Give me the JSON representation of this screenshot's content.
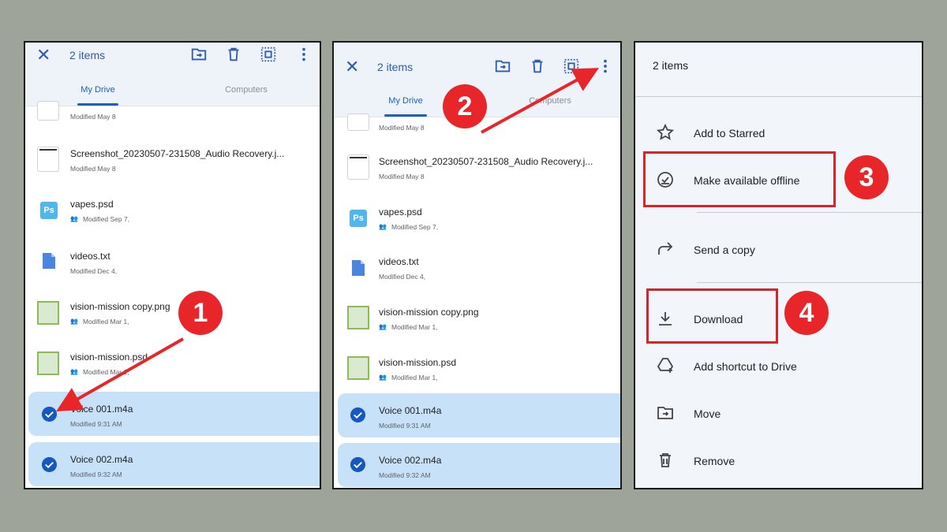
{
  "panel1": {
    "items_count": "2 items",
    "tabs": [
      "My Drive",
      "Computers"
    ],
    "files": [
      {
        "name": "",
        "meta": "Modified May 8",
        "icon": "document-thumbnail",
        "shared": false,
        "selected": false
      },
      {
        "name": "Screenshot_20230507-231508_Audio Recovery.j...",
        "meta": "Modified May 8",
        "icon": "document-thumbnail",
        "shared": false,
        "selected": false
      },
      {
        "name": "vapes.psd",
        "meta": "Modified Sep 7,",
        "icon": "photoshop-icon",
        "shared": true,
        "selected": false
      },
      {
        "name": "videos.txt",
        "meta": "Modified Dec 4,",
        "icon": "text-file-icon",
        "shared": false,
        "selected": false
      },
      {
        "name": "vision-mission copy.png",
        "meta": "Modified Mar 1,",
        "icon": "image-thumbnail",
        "shared": true,
        "selected": false
      },
      {
        "name": "vision-mission.psd",
        "meta": "Modified Mar 1,",
        "icon": "image-thumbnail",
        "shared": true,
        "selected": false
      },
      {
        "name": "Voice 001.m4a",
        "meta": "Modified 9:31 AM",
        "icon": "check-icon",
        "shared": false,
        "selected": true
      },
      {
        "name": "Voice 002.m4a",
        "meta": "Modified 9:32 AM",
        "icon": "check-icon",
        "shared": false,
        "selected": true
      }
    ]
  },
  "panel2": {
    "items_count": "2 items",
    "tabs": [
      "My Drive",
      "Computers"
    ],
    "files": [
      {
        "name": "",
        "meta": "Modified May 8",
        "icon": "document-thumbnail",
        "shared": false,
        "selected": false
      },
      {
        "name": "Screenshot_20230507-231508_Audio Recovery.j...",
        "meta": "Modified May 8",
        "icon": "document-thumbnail",
        "shared": false,
        "selected": false
      },
      {
        "name": "vapes.psd",
        "meta": "Modified Sep 7,",
        "icon": "photoshop-icon",
        "shared": true,
        "selected": false
      },
      {
        "name": "videos.txt",
        "meta": "Modified Dec 4,",
        "icon": "text-file-icon",
        "shared": false,
        "selected": false
      },
      {
        "name": "vision-mission copy.png",
        "meta": "Modified Mar 1,",
        "icon": "image-thumbnail",
        "shared": true,
        "selected": false
      },
      {
        "name": "vision-mission.psd",
        "meta": "Modified Mar 1,",
        "icon": "image-thumbnail",
        "shared": true,
        "selected": false
      },
      {
        "name": "Voice 001.m4a",
        "meta": "Modified 9:31 AM",
        "icon": "check-icon",
        "shared": false,
        "selected": true
      },
      {
        "name": "Voice 002.m4a",
        "meta": "Modified 9:32 AM",
        "icon": "check-icon",
        "shared": false,
        "selected": true
      }
    ]
  },
  "panel3": {
    "title": "2 items",
    "menu": [
      {
        "label": "Add to Starred",
        "icon": "star-icon"
      },
      {
        "label": "Make available offline",
        "icon": "offline-icon"
      },
      {
        "label": "Send a copy",
        "icon": "send-icon"
      },
      {
        "label": "Download",
        "icon": "download-icon"
      },
      {
        "label": "Add shortcut to Drive",
        "icon": "shortcut-icon"
      },
      {
        "label": "Move",
        "icon": "move-icon"
      },
      {
        "label": "Remove",
        "icon": "trash-icon"
      }
    ]
  },
  "steps": [
    "1",
    "2",
    "3",
    "4"
  ],
  "colors": {
    "background": "#9ea49a",
    "accent_blue": "#1f5fbf",
    "selection": "#c7e2f8",
    "step_red": "#e8262a"
  }
}
